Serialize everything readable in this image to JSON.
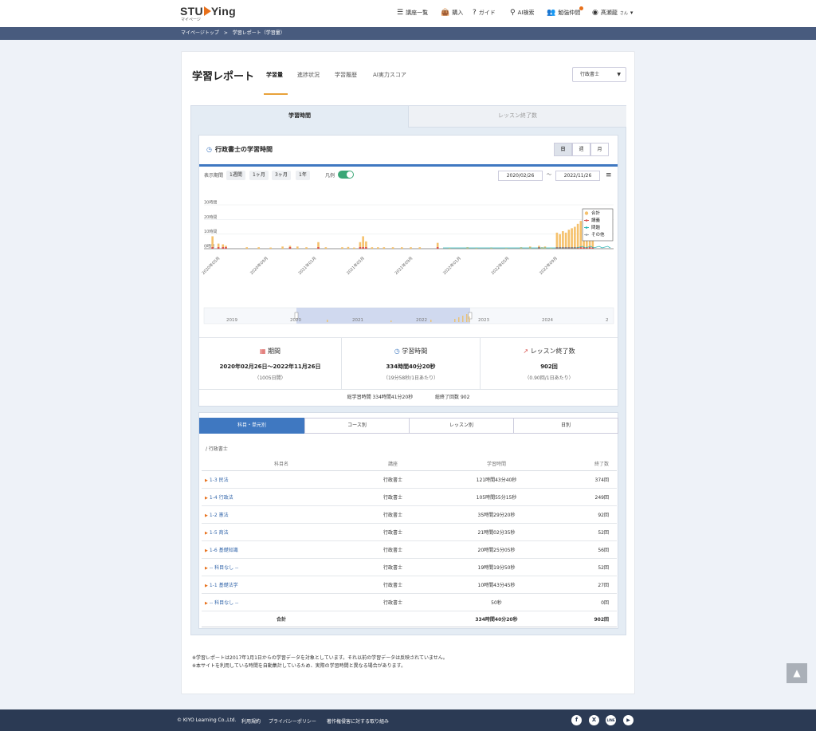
{
  "header": {
    "logo": "STUDYing",
    "logo_left": "STU",
    "logo_right": "Ying",
    "logo_sub": "マイページ",
    "nav": {
      "courses": "講座一覧",
      "purchase": "購入",
      "guide": "ガイド",
      "ai_search": "AI検索",
      "study_buddies": "勉強仲間",
      "user": "髙瀬龍",
      "user_suffix": "さん"
    }
  },
  "breadcrumb": {
    "home": "マイページトップ",
    "sep": ">",
    "current": "学習レポート（学習量）"
  },
  "report": {
    "title": "学習レポート",
    "tabs": [
      "学習量",
      "進捗状況",
      "学習履歴",
      "AI実力スコア"
    ],
    "exam_select": "行政書士"
  },
  "panel_tabs": {
    "study_time": "学習時間",
    "lessons": "レッスン終了数"
  },
  "chart_card": {
    "title": "行政書士の学習時間",
    "granularity": [
      "日",
      "週",
      "月"
    ],
    "period_label": "表示期間",
    "periods": [
      "1週間",
      "1ヶ月",
      "3ヶ月",
      "1年"
    ],
    "legend_label": "凡例",
    "date_from": "2020/02/26",
    "tilde": "～",
    "date_to": "2022/11/26"
  },
  "chart_data": {
    "type": "bar",
    "y_ticks": [
      "0時間",
      "10時間",
      "20時間",
      "30時間"
    ],
    "ylim": [
      0,
      30
    ],
    "x_ticks": [
      "2020年05月",
      "2020年09月",
      "2021年01月",
      "2021年05月",
      "2021年09月",
      "2022年01月",
      "2022年05月",
      "2022年09月"
    ],
    "legend": [
      "合計",
      "講義",
      "問題",
      "その他"
    ],
    "series_colors": {
      "合計": "#f5c16c",
      "講義": "#d9534f",
      "問題": "#2bb5b5",
      "その他": "#9aa3ad"
    },
    "navigator_years": [
      "2019",
      "2020",
      "2021",
      "2022",
      "2023",
      "2024",
      "2"
    ],
    "bars": [
      {
        "x": 0.265,
        "v": 8.5
      },
      {
        "x": 0.285,
        "v": 3.5
      },
      {
        "x": 0.3,
        "v": 3
      },
      {
        "x": 0.31,
        "v": 2
      },
      {
        "x": 0.38,
        "v": 1
      },
      {
        "x": 0.42,
        "v": 1
      },
      {
        "x": 0.46,
        "v": 0.8
      },
      {
        "x": 0.5,
        "v": 1.5
      },
      {
        "x": 0.525,
        "v": 2
      },
      {
        "x": 0.55,
        "v": 1.5
      },
      {
        "x": 0.58,
        "v": 1
      },
      {
        "x": 0.62,
        "v": 4.5
      },
      {
        "x": 0.645,
        "v": 1
      },
      {
        "x": 0.7,
        "v": 1
      },
      {
        "x": 0.72,
        "v": 1.2
      },
      {
        "x": 0.74,
        "v": 0.8
      },
      {
        "x": 0.76,
        "v": 4.5
      },
      {
        "x": 0.77,
        "v": 8.5
      },
      {
        "x": 0.78,
        "v": 5
      },
      {
        "x": 0.8,
        "v": 1
      },
      {
        "x": 0.82,
        "v": 1
      },
      {
        "x": 0.84,
        "v": 1
      },
      {
        "x": 0.87,
        "v": 1
      },
      {
        "x": 0.9,
        "v": 1
      },
      {
        "x": 0.93,
        "v": 1
      },
      {
        "x": 0.96,
        "v": 1
      },
      {
        "x": 1.02,
        "v": 4
      },
      {
        "x": 1.06,
        "v": 0.5
      },
      {
        "x": 1.12,
        "v": 1
      },
      {
        "x": 1.15,
        "v": 0.6
      },
      {
        "x": 1.2,
        "v": 0.8
      },
      {
        "x": 1.25,
        "v": 0.5
      },
      {
        "x": 1.3,
        "v": 1
      },
      {
        "x": 1.33,
        "v": 1.5
      },
      {
        "x": 1.36,
        "v": 2
      },
      {
        "x": 1.37,
        "v": 1
      },
      {
        "x": 1.38,
        "v": 1.5
      },
      {
        "x": 1.4,
        "v": 0.5
      },
      {
        "x": 1.42,
        "v": 11
      },
      {
        "x": 1.43,
        "v": 10
      },
      {
        "x": 1.44,
        "v": 12
      },
      {
        "x": 1.45,
        "v": 11
      },
      {
        "x": 1.46,
        "v": 13
      },
      {
        "x": 1.47,
        "v": 14
      },
      {
        "x": 1.48,
        "v": 15
      },
      {
        "x": 1.49,
        "v": 17
      },
      {
        "x": 1.5,
        "v": 19
      },
      {
        "x": 1.51,
        "v": 22
      },
      {
        "x": 1.52,
        "v": 23
      },
      {
        "x": 1.53,
        "v": 20
      },
      {
        "x": 1.54,
        "v": 24
      }
    ]
  },
  "stats": {
    "period": {
      "label": "期間",
      "value": "2020年02月26日～2022年11月26日",
      "sub": "（1005日間）"
    },
    "time": {
      "label": "学習時間",
      "value_main": "334時間40分20秒",
      "sub": "（19分58秒/1日あたり）"
    },
    "lessons": {
      "label": "レッスン終了数",
      "value": "902回",
      "sub": "（0.90回/1日あたり）"
    },
    "totals_time": "総学習時間 334時間41分20秒",
    "totals_count": "総終了回数 902"
  },
  "subjects": {
    "tabs": [
      "科目・単元別",
      "コース別",
      "レッスン別",
      "日別"
    ],
    "breadcrumb": "/ 行政書士",
    "columns": [
      "科目名",
      "講座",
      "学習時間",
      "終了数"
    ],
    "rows": [
      {
        "name": "1-3 民法",
        "course": "行政書士",
        "time": "121時間43分40秒",
        "count": "374回"
      },
      {
        "name": "1-4 行政法",
        "course": "行政書士",
        "time": "105時間55分15秒",
        "count": "249回"
      },
      {
        "name": "1-2 憲法",
        "course": "行政書士",
        "time": "35時間29分20秒",
        "count": "92回"
      },
      {
        "name": "1-5 商法",
        "course": "行政書士",
        "time": "21時間02分35秒",
        "count": "52回"
      },
      {
        "name": "1-6 基礎知識",
        "course": "行政書士",
        "time": "20時間25分05秒",
        "count": "56回"
      },
      {
        "name": "-- 科目なし --",
        "course": "行政書士",
        "time": "19時間19分50秒",
        "count": "52回"
      },
      {
        "name": "1-1 基礎法学",
        "course": "行政書士",
        "time": "10時間43分45秒",
        "count": "27回"
      },
      {
        "name": "-- 科目なし --",
        "course": "行政書士",
        "time": "50秒",
        "count": "0回"
      }
    ],
    "total_label": "合計",
    "total_time": "334時間40分20秒",
    "total_count": "902回"
  },
  "notes": [
    "※学習レポートは2017年1月1日からの学習データを対象としています。それ以前の学習データは反映されていません。",
    "※本サイトを利用している時間を自動集計しているため、実際の学習時間と異なる場合があります。"
  ],
  "footer": {
    "copyright": "© KIYO Learning Co.,Ltd.",
    "links": [
      "利用規約",
      "プライバシーポリシー",
      "著作権侵害に対する取り組み"
    ],
    "social": [
      "f",
      "X",
      "LINE",
      "▶"
    ]
  }
}
